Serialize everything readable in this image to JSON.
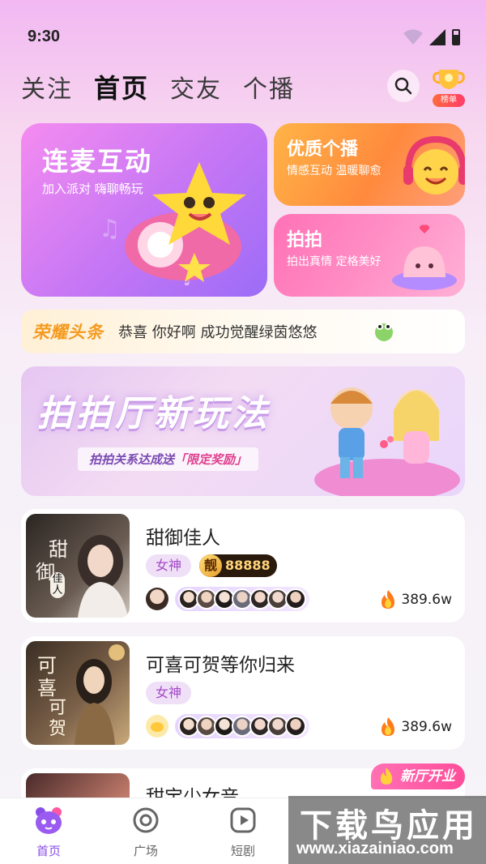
{
  "status_bar": {
    "time": "9:30"
  },
  "top_nav": {
    "tabs": [
      {
        "label": "关注"
      },
      {
        "label": "首页"
      },
      {
        "label": "交友"
      },
      {
        "label": "个播"
      }
    ],
    "active_tab": "首页",
    "rank_label": "榜单"
  },
  "features": {
    "big": {
      "title": "连麦互动",
      "subtitle": "加入派对 嗨聊畅玩"
    },
    "quality": {
      "title": "优质个播",
      "subtitle": "情感互动 温暖聊愈"
    },
    "paipai": {
      "title": "拍拍",
      "subtitle": "拍出真情 定格美好"
    }
  },
  "headline": {
    "tag": "荣耀头条",
    "message": "恭喜 你好啊 成功觉醒绿茵悠悠"
  },
  "banner": {
    "title": "拍拍厅新玩法",
    "subtitle_prefix": "拍拍关系达成送",
    "subtitle_highlight": "「限定奖励」"
  },
  "rooms": [
    {
      "name": "甜御佳人",
      "tag": "女神",
      "number_badge_char": "靓",
      "number": "88888",
      "heat": "389.6w",
      "thumb_text_1": "甜",
      "thumb_text_2": "御",
      "thumb_text_3": "佳人"
    },
    {
      "name": "可喜可贺等你归来",
      "tag": "女神",
      "heat": "389.6w",
      "thumb_text_1": "可喜",
      "thumb_text_2": "可贺"
    },
    {
      "name": "甜宝少女音",
      "badge": "新厅开业"
    }
  ],
  "tab_bar": {
    "items": [
      {
        "label": "首页"
      },
      {
        "label": "广场"
      },
      {
        "label": "短剧"
      }
    ]
  },
  "watermark": {
    "text": "下载鸟应用",
    "url": "www.xiazainiao.com"
  },
  "colors": {
    "accent": "#8a4ee8",
    "headline_tag": "#f59a1f",
    "goddess_tag": "#a44bc8"
  }
}
